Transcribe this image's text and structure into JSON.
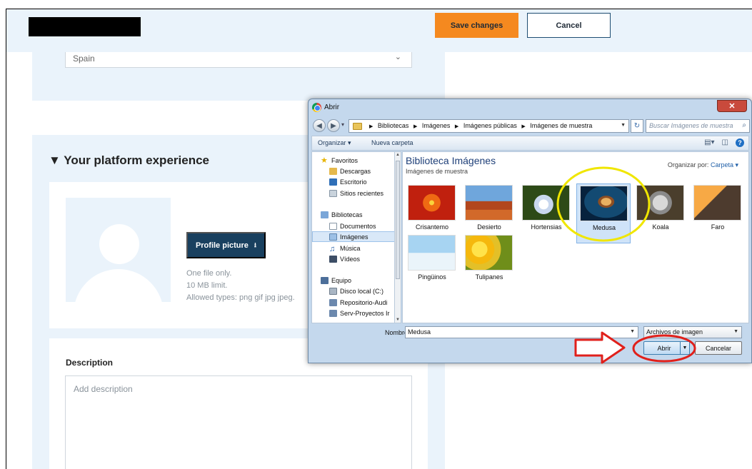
{
  "page": {
    "save_label": "Save changes",
    "cancel_label": "Cancel",
    "country_value": "Spain",
    "experience_heading": "▼ Your platform experience",
    "profile_button_label": "Profile picture",
    "hints": [
      "One file only.",
      "10 MB limit.",
      "Allowed types: png gif jpg jpeg."
    ],
    "description_label": "Description",
    "description_placeholder": "Add description"
  },
  "dialog": {
    "title": "Abrir",
    "breadcrumbs": [
      "Bibliotecas",
      "Imágenes",
      "Imágenes públicas",
      "Imágenes de muestra"
    ],
    "search_placeholder": "Buscar Imágenes de muestra",
    "toolbar": {
      "organize": "Organizar ▾",
      "new_folder": "Nueva carpeta"
    },
    "nav": {
      "favoritos": "Favoritos",
      "descargas": "Descargas",
      "escritorio": "Escritorio",
      "recientes": "Sitios recientes",
      "bibliotecas": "Bibliotecas",
      "documentos": "Documentos",
      "imagenes": "Imágenes",
      "musica": "Música",
      "videos": "Vídeos",
      "equipo": "Equipo",
      "disco": "Disco local (C:)",
      "repositorio": "Repositorio-Audi",
      "serv": "Serv-Proyectos Ir"
    },
    "library_title": "Biblioteca Imágenes",
    "library_subtitle": "Imágenes de muestra",
    "organize_by_label": "Organizar por:",
    "organize_by_value": "Carpeta ▾",
    "images": [
      "Crisantemo",
      "Desierto",
      "Hortensias",
      "Medusa",
      "Koala",
      "Faro",
      "Pingüinos",
      "Tulipanes"
    ],
    "selected_image": "Medusa",
    "filename_label": "Nombre:",
    "filename_value": "Medusa",
    "filetype_value": "Archivos de imagen",
    "open_label": "Abrir",
    "cancel_label": "Cancelar"
  },
  "annotations": {
    "highlight_color": "#f0e600",
    "arrow_color": "#e0201b"
  }
}
